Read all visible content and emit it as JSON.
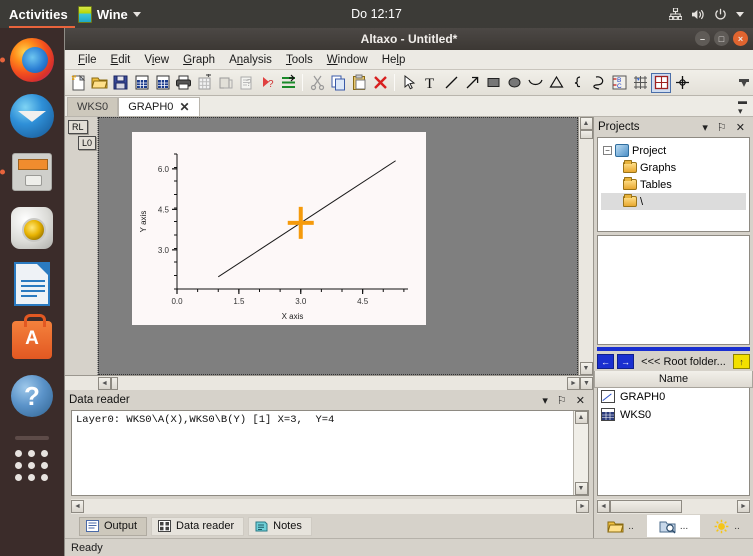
{
  "desktop": {
    "activities": "Activities",
    "app_menu": {
      "name": "Wine",
      "icon": "wine-icon"
    },
    "clock": "Do 12:17",
    "status_icons": [
      "network-icon",
      "volume-icon",
      "power-icon",
      "chevron-down-icon"
    ],
    "dock_items": [
      {
        "name": "firefox",
        "running": true
      },
      {
        "name": "thunderbird",
        "running": false
      },
      {
        "name": "files",
        "running": true
      },
      {
        "name": "rhythmbox",
        "running": false
      },
      {
        "name": "libreoffice-writer",
        "running": false
      },
      {
        "name": "ubuntu-software",
        "running": false
      },
      {
        "name": "help",
        "running": false
      },
      {
        "name": "show-applications",
        "running": false
      }
    ]
  },
  "window": {
    "title": "Altaxo - Untitled*",
    "buttons": {
      "minimize": "–",
      "maximize": "□",
      "close": "×"
    }
  },
  "menubar": [
    {
      "label": "File",
      "mnemonic": "F"
    },
    {
      "label": "Edit",
      "mnemonic": "E"
    },
    {
      "label": "View",
      "mnemonic": "i"
    },
    {
      "label": "Graph",
      "mnemonic": "G"
    },
    {
      "label": "Analysis",
      "mnemonic": "n"
    },
    {
      "label": "Tools",
      "mnemonic": "T"
    },
    {
      "label": "Window",
      "mnemonic": "W"
    },
    {
      "label": "Help",
      "mnemonic": "H"
    }
  ],
  "toolbar": {
    "group1": [
      "new-document-icon",
      "open-folder-icon",
      "save-icon",
      "new-worksheet-icon",
      "new-graph-icon",
      "print-icon",
      "worksheet-grid-icon",
      "duplicate-icon",
      "help-list-icon",
      "run-script-icon",
      "import-icon"
    ],
    "group2": [
      "cut-icon",
      "copy-icon",
      "paste-icon",
      "delete-icon"
    ],
    "group3": [
      "pointer-icon",
      "text-icon",
      "line-icon",
      "arrow-icon",
      "rectangle-icon",
      "ellipse-icon",
      "curve-icon",
      "triangle-icon",
      "spline-icon",
      "freehand-icon",
      "bind-bc-icon",
      "grid-icon",
      "plot-frame-icon",
      "crosshair-icon"
    ],
    "overflow": "toolbar-overflow-icon"
  },
  "document_tabs": {
    "tabs": [
      {
        "label": "WKS0",
        "active": false,
        "closable": false
      },
      {
        "label": "GRAPH0",
        "active": true,
        "closable": true,
        "close_glyph": "✕"
      }
    ],
    "menu_glyph": "≡"
  },
  "graph_view": {
    "layer_buttons": [
      {
        "label": "RL"
      },
      {
        "label": "L0"
      }
    ],
    "scroll": {
      "up": "▲",
      "down": "▼",
      "left": "◄",
      "right": "►",
      "dropdown": "▼"
    }
  },
  "chart_data": {
    "type": "line",
    "title": "",
    "xlabel": "X axis",
    "ylabel": "Y axis",
    "xlim": [
      0.0,
      5.6
    ],
    "ylim": [
      1.55,
      6.55
    ],
    "xticks": [
      0.0,
      1.5,
      3.0,
      4.5
    ],
    "xticklabels": [
      "0.0",
      "1.5",
      "3.0",
      "4.5"
    ],
    "yticks": [
      3.0,
      4.5,
      6.0
    ],
    "yticklabels": [
      "3.0",
      "4.5",
      "6.0"
    ],
    "x_minor_interval": 0.5,
    "y_minor_interval": 0.5,
    "grid": false,
    "legend": null,
    "series": [
      {
        "name": "WKS0\\A(X),WKS0\\B(Y)",
        "line_color": "#1a1a1a",
        "x": [
          1.0,
          2.0,
          3.0,
          4.0,
          5.0,
          5.3
        ],
        "y": [
          2.0,
          3.0,
          4.0,
          5.0,
          6.0,
          6.3
        ]
      }
    ],
    "annotations": [
      {
        "type": "crosshair-marker",
        "x": 3.0,
        "y": 4.0,
        "color": "#f59a0b",
        "label": "data reader cursor"
      }
    ],
    "plot_background": "#fdf8f8",
    "canvas_background": "#7f7f7f"
  },
  "data_reader": {
    "title": "Data reader",
    "tools": {
      "menu": "▾",
      "pin": "⚐",
      "close": "✕"
    },
    "content": "Layer0: WKS0\\A(X),WKS0\\B(Y) [1] X=3,  Y=4"
  },
  "bottom_tabs": [
    {
      "label": "Output",
      "icon": "output-icon",
      "active": true
    },
    {
      "label": "Data reader",
      "icon": "data-reader-icon",
      "active": false
    },
    {
      "label": "Notes",
      "icon": "notes-icon",
      "active": false
    }
  ],
  "projects": {
    "title": "Projects",
    "tools": {
      "menu": "▾",
      "pin": "⚐",
      "close": "✕"
    },
    "tree": [
      {
        "label": "Project",
        "level": 0,
        "icon": "project-icon",
        "expander": "−"
      },
      {
        "label": "Graphs",
        "level": 1,
        "icon": "folder-icon"
      },
      {
        "label": "Tables",
        "level": 1,
        "icon": "folder-icon"
      },
      {
        "label": "\\",
        "level": 1,
        "icon": "folder-open-icon",
        "selected": true
      }
    ],
    "navigation": {
      "back": "←",
      "forward": "→",
      "path_label": "<<< Root folder...",
      "up": "↑"
    },
    "list_header": "Name",
    "list_items": [
      {
        "label": "GRAPH0",
        "icon": "graph-file-icon"
      },
      {
        "label": "WKS0",
        "icon": "worksheet-file-icon"
      }
    ],
    "scroll": {
      "left": "◄",
      "right": "►"
    },
    "bottom_tabs": [
      {
        "icon": "open-folder-icon",
        "label": "..",
        "active": false
      },
      {
        "icon": "search-folder-icon",
        "label": "...",
        "active": true
      },
      {
        "icon": "sun-icon",
        "label": "..",
        "active": false
      }
    ]
  },
  "statusbar": {
    "text": "Ready"
  }
}
